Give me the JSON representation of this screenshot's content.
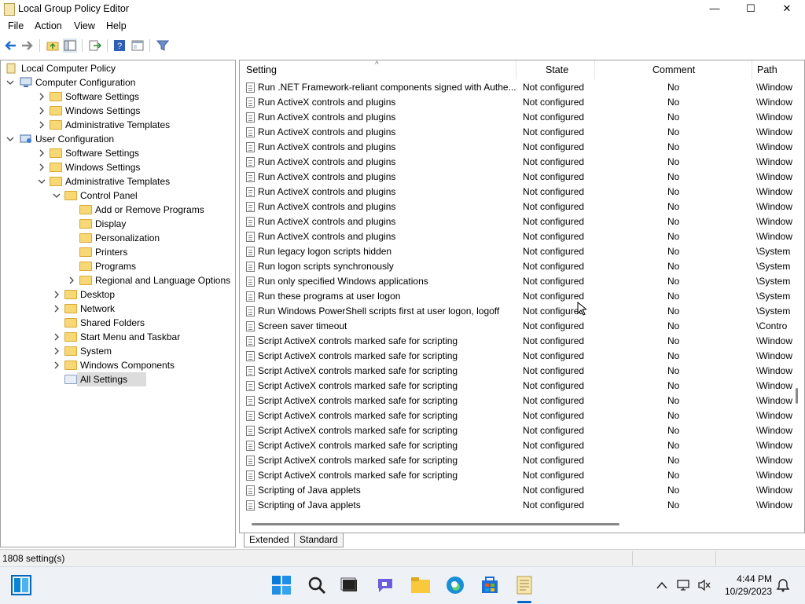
{
  "window": {
    "title": "Local Group Policy Editor",
    "minimize_glyph": "—",
    "maximize_glyph": "☐",
    "close_glyph": "✕"
  },
  "menu": [
    "File",
    "Action",
    "View",
    "Help"
  ],
  "toolbar": {
    "icons": [
      "back-arrow-icon",
      "forward-arrow-icon",
      "up-folder-icon",
      "show-hide-tree-icon",
      "export-list-icon",
      "help-icon",
      "properties-icon",
      "filter-icon"
    ]
  },
  "tree": {
    "items": [
      {
        "label": "Local Computer Policy",
        "level": 0,
        "arrow": "",
        "icon": "computer-policy-icon"
      },
      {
        "label": "Computer Configuration",
        "level": 1,
        "arrow": "v",
        "icon": "computer-icon"
      },
      {
        "label": "Software Settings",
        "level": 2,
        "arrow": ">",
        "icon": "folder-icon"
      },
      {
        "label": "Windows Settings",
        "level": 2,
        "arrow": ">",
        "icon": "folder-icon"
      },
      {
        "label": "Administrative Templates",
        "level": 2,
        "arrow": ">",
        "icon": "folder-icon"
      },
      {
        "label": "User Configuration",
        "level": 1,
        "arrow": "v",
        "icon": "user-icon"
      },
      {
        "label": "Software Settings",
        "level": 2,
        "arrow": ">",
        "icon": "folder-icon"
      },
      {
        "label": "Windows Settings",
        "level": 2,
        "arrow": ">",
        "icon": "folder-icon"
      },
      {
        "label": "Administrative Templates",
        "level": 2,
        "arrow": "v",
        "icon": "folder-icon"
      },
      {
        "label": "Control Panel",
        "level": 3,
        "arrow": "v",
        "icon": "folder-icon"
      },
      {
        "label": "Add or Remove Programs",
        "level": 4,
        "arrow": "",
        "icon": "folder-icon"
      },
      {
        "label": "Display",
        "level": 4,
        "arrow": "",
        "icon": "folder-icon"
      },
      {
        "label": "Personalization",
        "level": 4,
        "arrow": "",
        "icon": "folder-icon"
      },
      {
        "label": "Printers",
        "level": 4,
        "arrow": "",
        "icon": "folder-icon"
      },
      {
        "label": "Programs",
        "level": 4,
        "arrow": "",
        "icon": "folder-icon"
      },
      {
        "label": "Regional and Language Options",
        "level": 4,
        "arrow": ">",
        "icon": "folder-icon"
      },
      {
        "label": "Desktop",
        "level": 3,
        "arrow": ">",
        "icon": "folder-icon"
      },
      {
        "label": "Network",
        "level": 3,
        "arrow": ">",
        "icon": "folder-icon"
      },
      {
        "label": "Shared Folders",
        "level": 3,
        "arrow": "",
        "icon": "folder-icon"
      },
      {
        "label": "Start Menu and Taskbar",
        "level": 3,
        "arrow": ">",
        "icon": "folder-icon"
      },
      {
        "label": "System",
        "level": 3,
        "arrow": ">",
        "icon": "folder-icon"
      },
      {
        "label": "Windows Components",
        "level": 3,
        "arrow": ">",
        "icon": "folder-icon"
      },
      {
        "label": "All Settings",
        "level": 3,
        "arrow": "",
        "icon": "all-settings-icon",
        "selected": true
      }
    ]
  },
  "list": {
    "columns": [
      "Setting",
      "State",
      "Comment",
      "Path"
    ],
    "sort_glyph": "^",
    "rows": [
      [
        "Run .NET Framework-reliant components signed with Authe...",
        "Not configured",
        "No",
        "\\Window"
      ],
      [
        "Run ActiveX controls and plugins",
        "Not configured",
        "No",
        "\\Window"
      ],
      [
        "Run ActiveX controls and plugins",
        "Not configured",
        "No",
        "\\Window"
      ],
      [
        "Run ActiveX controls and plugins",
        "Not configured",
        "No",
        "\\Window"
      ],
      [
        "Run ActiveX controls and plugins",
        "Not configured",
        "No",
        "\\Window"
      ],
      [
        "Run ActiveX controls and plugins",
        "Not configured",
        "No",
        "\\Window"
      ],
      [
        "Run ActiveX controls and plugins",
        "Not configured",
        "No",
        "\\Window"
      ],
      [
        "Run ActiveX controls and plugins",
        "Not configured",
        "No",
        "\\Window"
      ],
      [
        "Run ActiveX controls and plugins",
        "Not configured",
        "No",
        "\\Window"
      ],
      [
        "Run ActiveX controls and plugins",
        "Not configured",
        "No",
        "\\Window"
      ],
      [
        "Run ActiveX controls and plugins",
        "Not configured",
        "No",
        "\\Window"
      ],
      [
        "Run legacy logon scripts hidden",
        "Not configured",
        "No",
        "\\System"
      ],
      [
        "Run logon scripts synchronously",
        "Not configured",
        "No",
        "\\System"
      ],
      [
        "Run only specified Windows applications",
        "Not configured",
        "No",
        "\\System"
      ],
      [
        "Run these programs at user logon",
        "Not configured",
        "No",
        "\\System"
      ],
      [
        "Run Windows PowerShell scripts first at user logon, logoff",
        "Not configured",
        "No",
        "\\System"
      ],
      [
        "Screen saver timeout",
        "Not configured",
        "No",
        "\\Contro"
      ],
      [
        "Script ActiveX controls marked safe for scripting",
        "Not configured",
        "No",
        "\\Window"
      ],
      [
        "Script ActiveX controls marked safe for scripting",
        "Not configured",
        "No",
        "\\Window"
      ],
      [
        "Script ActiveX controls marked safe for scripting",
        "Not configured",
        "No",
        "\\Window"
      ],
      [
        "Script ActiveX controls marked safe for scripting",
        "Not configured",
        "No",
        "\\Window"
      ],
      [
        "Script ActiveX controls marked safe for scripting",
        "Not configured",
        "No",
        "\\Window"
      ],
      [
        "Script ActiveX controls marked safe for scripting",
        "Not configured",
        "No",
        "\\Window"
      ],
      [
        "Script ActiveX controls marked safe for scripting",
        "Not configured",
        "No",
        "\\Window"
      ],
      [
        "Script ActiveX controls marked safe for scripting",
        "Not configured",
        "No",
        "\\Window"
      ],
      [
        "Script ActiveX controls marked safe for scripting",
        "Not configured",
        "No",
        "\\Window"
      ],
      [
        "Script ActiveX controls marked safe for scripting",
        "Not configured",
        "No",
        "\\Window"
      ],
      [
        "Scripting of Java applets",
        "Not configured",
        "No",
        "\\Window"
      ],
      [
        "Scripting of Java applets",
        "Not configured",
        "No",
        "\\Window"
      ]
    ]
  },
  "tabs": [
    "Extended",
    "Standard"
  ],
  "status": {
    "text": "1808 setting(s)"
  },
  "taskbar": {
    "apps": [
      "start-icon",
      "search-icon",
      "task-view-icon",
      "chat-icon",
      "file-explorer-icon",
      "edge-icon",
      "store-icon",
      "group-policy-app-icon"
    ],
    "time": "4:44 PM",
    "date": "10/29/2023",
    "tray": [
      "chevron-up-icon",
      "network-icon",
      "volume-muted-icon",
      "notification-icon"
    ]
  },
  "colors": {
    "accent": "#0067c0",
    "folder": "#f8d775",
    "selection": "#dcdcdc"
  }
}
